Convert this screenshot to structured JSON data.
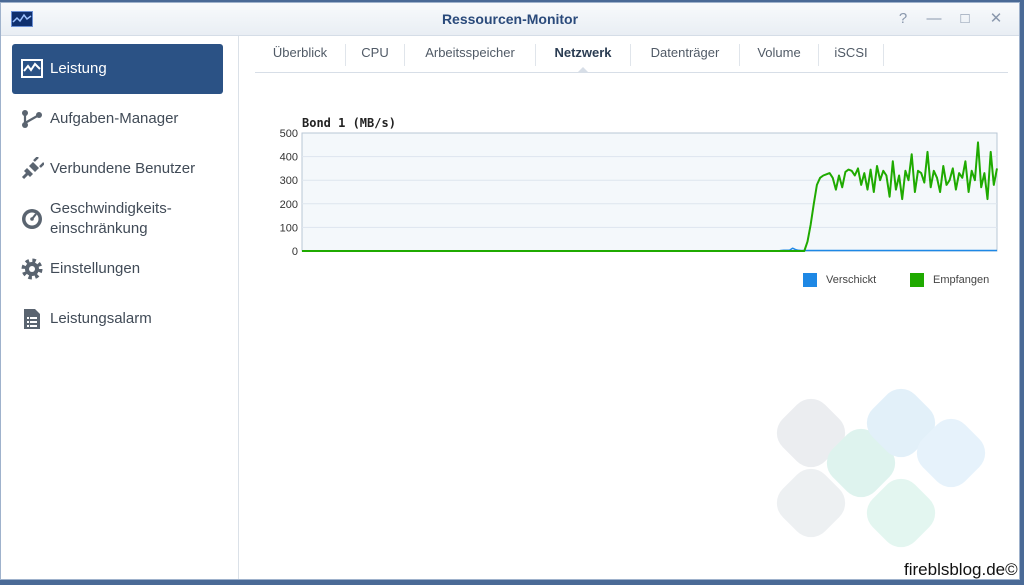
{
  "window": {
    "title": "Ressourcen-Monitor"
  },
  "window_controls": {
    "help": "?",
    "minimize": "—",
    "maximize": "□",
    "close": "✕"
  },
  "sidebar": {
    "items": [
      {
        "label": "Leistung",
        "icon": "performance-chart-icon",
        "active": true
      },
      {
        "label": "Aufgaben-Manager",
        "icon": "task-manager-icon",
        "active": false
      },
      {
        "label": "Verbundene Benutzer",
        "icon": "plug-icon",
        "active": false
      },
      {
        "label": "Geschwindigkeits-\neinschränkung",
        "icon": "speedometer-icon",
        "active": false
      },
      {
        "label": "Einstellungen",
        "icon": "gear-icon",
        "active": false
      },
      {
        "label": "Leistungsalarm",
        "icon": "document-list-icon",
        "active": false
      }
    ]
  },
  "tabs": [
    {
      "label": "Überblick",
      "active": false
    },
    {
      "label": "CPU",
      "active": false
    },
    {
      "label": "Arbeitsspeicher",
      "active": false
    },
    {
      "label": "Netzwerk",
      "active": true
    },
    {
      "label": "Datenträger",
      "active": false
    },
    {
      "label": "Volume",
      "active": false
    },
    {
      "label": "iSCSI",
      "active": false
    }
  ],
  "colors": {
    "accent": "#2b5285",
    "sent": "#1e88e5",
    "received": "#1faa00"
  },
  "chart_data": {
    "type": "line",
    "title": "Bond 1 (MB/s)",
    "ylim": [
      0,
      500
    ],
    "yticks": [
      "500",
      "400",
      "300",
      "200",
      "100",
      "0"
    ],
    "grid": true,
    "legend_position": "bottom-right",
    "series": [
      {
        "name": "Verschickt",
        "values": [
          0,
          0,
          0,
          0,
          0,
          0,
          0,
          0,
          0,
          0,
          0,
          0,
          0,
          0,
          0,
          0,
          0,
          0,
          0,
          0,
          0,
          0,
          0,
          0,
          0,
          0,
          0,
          0,
          0,
          0,
          0,
          0,
          0,
          0,
          0,
          0,
          0,
          0,
          0,
          0,
          0,
          0,
          0,
          0,
          0,
          0,
          0,
          0,
          0,
          0,
          0,
          0,
          0,
          0,
          0,
          0,
          0,
          0,
          0,
          0,
          0,
          0,
          0,
          0,
          0,
          0,
          0,
          0,
          0,
          0,
          0,
          0,
          0,
          0,
          0,
          0,
          0,
          0,
          0,
          0,
          0,
          0,
          0,
          0,
          0,
          0,
          0,
          0,
          0,
          0,
          0,
          0,
          0,
          0,
          0,
          0,
          0,
          0,
          0,
          0,
          0,
          0,
          0,
          0,
          0,
          0,
          0,
          0,
          0,
          0,
          0,
          0,
          0,
          0,
          0,
          0,
          0,
          0,
          0,
          0,
          0,
          0,
          0,
          0,
          0,
          0,
          0,
          0,
          0,
          0,
          0,
          0,
          0,
          0,
          0,
          0,
          0,
          0,
          0,
          0,
          0,
          0,
          0,
          0,
          0,
          0,
          0,
          0,
          0,
          0,
          0,
          0,
          0,
          0,
          0,
          0,
          0,
          0,
          0,
          0,
          0,
          0,
          0,
          0,
          2,
          3,
          3,
          4,
          12,
          6,
          3,
          2,
          2,
          2,
          2,
          2,
          2,
          2,
          2,
          2,
          2,
          2,
          2,
          2,
          2,
          2,
          2,
          2,
          2,
          2,
          2,
          2,
          2,
          2,
          2,
          2,
          2,
          2,
          2,
          2,
          2,
          2,
          2,
          2,
          2,
          2,
          2,
          2,
          2,
          2,
          2,
          2,
          2,
          2,
          2,
          2,
          2,
          2,
          2,
          2,
          2,
          2,
          2,
          2,
          2,
          2,
          2,
          2,
          2,
          2,
          2,
          2,
          2,
          2,
          2,
          2,
          2,
          2,
          2
        ]
      },
      {
        "name": "Empfangen",
        "values": [
          0,
          0,
          0,
          0,
          0,
          0,
          0,
          0,
          0,
          0,
          0,
          0,
          0,
          0,
          0,
          0,
          0,
          0,
          0,
          0,
          0,
          0,
          0,
          0,
          0,
          0,
          0,
          0,
          0,
          0,
          0,
          0,
          0,
          0,
          0,
          0,
          0,
          0,
          0,
          0,
          0,
          0,
          0,
          0,
          0,
          0,
          0,
          0,
          0,
          0,
          0,
          0,
          0,
          0,
          0,
          0,
          0,
          0,
          0,
          0,
          0,
          0,
          0,
          0,
          0,
          0,
          0,
          0,
          0,
          0,
          0,
          0,
          0,
          0,
          0,
          0,
          0,
          0,
          0,
          0,
          0,
          0,
          0,
          0,
          0,
          0,
          0,
          0,
          0,
          0,
          0,
          0,
          0,
          0,
          0,
          0,
          0,
          0,
          0,
          0,
          0,
          0,
          0,
          0,
          0,
          0,
          0,
          0,
          0,
          0,
          0,
          0,
          0,
          0,
          0,
          0,
          0,
          0,
          0,
          0,
          0,
          0,
          0,
          0,
          0,
          0,
          0,
          0,
          0,
          0,
          0,
          0,
          0,
          0,
          0,
          0,
          0,
          0,
          0,
          0,
          0,
          0,
          0,
          0,
          0,
          0,
          0,
          0,
          0,
          0,
          0,
          0,
          0,
          0,
          0,
          0,
          0,
          0,
          0,
          0,
          40,
          110,
          200,
          280,
          310,
          320,
          325,
          330,
          310,
          260,
          320,
          270,
          335,
          345,
          340,
          320,
          350,
          280,
          330,
          260,
          345,
          250,
          360,
          300,
          340,
          320,
          230,
          380,
          260,
          320,
          220,
          340,
          300,
          410,
          250,
          340,
          330,
          290,
          420,
          270,
          340,
          310,
          250,
          360,
          280,
          300,
          350,
          260,
          330,
          310,
          380,
          250,
          340,
          300,
          460,
          270,
          330,
          220,
          420,
          280,
          350
        ]
      }
    ]
  },
  "watermark": {
    "text": "fireblsblog.de©",
    "logo": "synology-logo-watermark"
  }
}
